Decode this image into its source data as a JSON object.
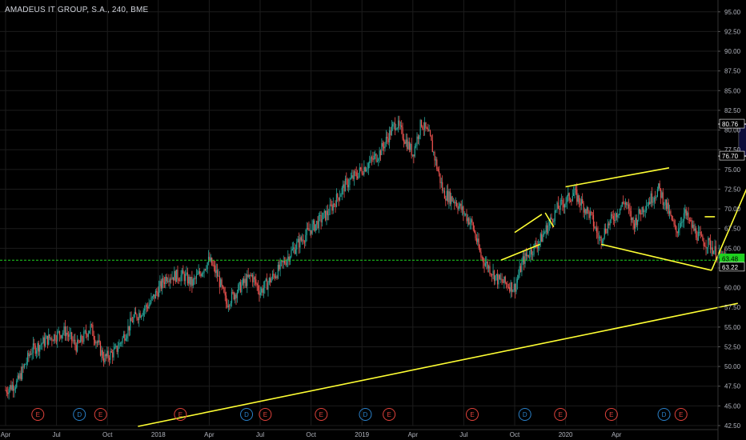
{
  "header": {
    "title": "AMADEUS IT GROUP, S.A., 240, BME"
  },
  "colors": {
    "background": "#000000",
    "axis_text": "#b2b5be",
    "grid": "#1c1c1c",
    "up": "#26a69a",
    "down": "#ef5350",
    "price_line": "#1fd01f",
    "drawing": "#ffff33",
    "white": "#ffffff",
    "box_fill": "#0c0c3a",
    "event_e": "#e0423b",
    "event_d": "#2a80c8"
  },
  "chart_data": {
    "type": "candlestick",
    "ylim": [
      42.5,
      96.5
    ],
    "y_ticks": [
      42.5,
      45.0,
      47.5,
      50.0,
      52.5,
      55.0,
      57.5,
      60.0,
      62.5,
      65.0,
      67.5,
      70.0,
      72.5,
      75.0,
      77.5,
      80.0,
      82.5,
      85.0,
      87.5,
      90.0,
      92.5,
      95.0
    ],
    "x_ticks": [
      "Apr",
      "Jul",
      "Oct",
      "2018",
      "Apr",
      "Jul",
      "Oct",
      "2019",
      "Apr",
      "Jul",
      "Oct",
      "2020",
      "Apr"
    ],
    "price_path": [
      [
        0,
        47
      ],
      [
        0.7,
        48
      ],
      [
        1.5,
        52
      ],
      [
        2.5,
        53.5
      ],
      [
        3.5,
        54.5
      ],
      [
        4.2,
        52.5
      ],
      [
        5,
        55
      ],
      [
        5.8,
        51
      ],
      [
        6.5,
        52
      ],
      [
        7.5,
        56
      ],
      [
        8.5,
        58
      ],
      [
        9.5,
        61.5
      ],
      [
        10.5,
        61.5
      ],
      [
        11,
        60.5
      ],
      [
        12,
        63.5
      ],
      [
        12.5,
        61.5
      ],
      [
        13,
        58
      ],
      [
        14,
        60.5
      ],
      [
        14.5,
        61.5
      ],
      [
        15,
        59.5
      ],
      [
        16,
        62
      ],
      [
        17,
        65
      ],
      [
        18,
        67.5
      ],
      [
        19,
        69.5
      ],
      [
        20,
        73
      ],
      [
        21,
        75
      ],
      [
        22,
        77
      ],
      [
        23,
        81
      ],
      [
        23.5,
        79
      ],
      [
        24,
        77
      ],
      [
        24.5,
        81
      ],
      [
        25,
        79
      ],
      [
        25.8,
        72
      ],
      [
        26.5,
        71
      ],
      [
        27.5,
        68
      ],
      [
        28,
        64
      ],
      [
        29,
        61
      ],
      [
        30,
        60
      ],
      [
        30.5,
        63.5
      ],
      [
        31.5,
        66
      ],
      [
        32,
        68
      ],
      [
        32.5,
        70
      ],
      [
        33.5,
        72
      ],
      [
        34.5,
        69
      ],
      [
        35,
        66
      ],
      [
        35.5,
        68
      ],
      [
        36.5,
        71
      ],
      [
        37,
        68
      ],
      [
        37.5,
        70
      ],
      [
        38.5,
        72.5
      ],
      [
        39,
        70
      ],
      [
        39.5,
        67
      ],
      [
        40,
        69.5
      ],
      [
        40.5,
        67.5
      ],
      [
        41,
        66
      ],
      [
        41.5,
        65.5
      ],
      [
        42,
        64
      ],
      [
        42.5,
        63.4
      ]
    ],
    "last_price": 63.48,
    "horizontal_line": 63.48,
    "price_labels": [
      {
        "text": "80.76",
        "value": 80.76
      },
      {
        "text": "76.70",
        "value": 76.7
      },
      {
        "text": "63.48",
        "value": 63.48
      },
      {
        "text": "63.22",
        "value": 63.22
      }
    ],
    "events": [
      {
        "label": "E",
        "x": 1.9
      },
      {
        "label": "D",
        "x": 4.35
      },
      {
        "label": "E",
        "x": 5.6
      },
      {
        "label": "E",
        "x": 10.3
      },
      {
        "label": "D",
        "x": 14.2
      },
      {
        "label": "E",
        "x": 15.3
      },
      {
        "label": "E",
        "x": 18.6
      },
      {
        "label": "D",
        "x": 21.2
      },
      {
        "label": "E",
        "x": 22.6
      },
      {
        "label": "E",
        "x": 27.5
      },
      {
        "label": "D",
        "x": 30.6
      },
      {
        "label": "E",
        "x": 32.7
      },
      {
        "label": "E",
        "x": 35.7
      },
      {
        "label": "D",
        "x": 38.8
      },
      {
        "label": "E",
        "x": 39.8
      },
      {
        "label": "E",
        "x": 44.5
      }
    ]
  }
}
